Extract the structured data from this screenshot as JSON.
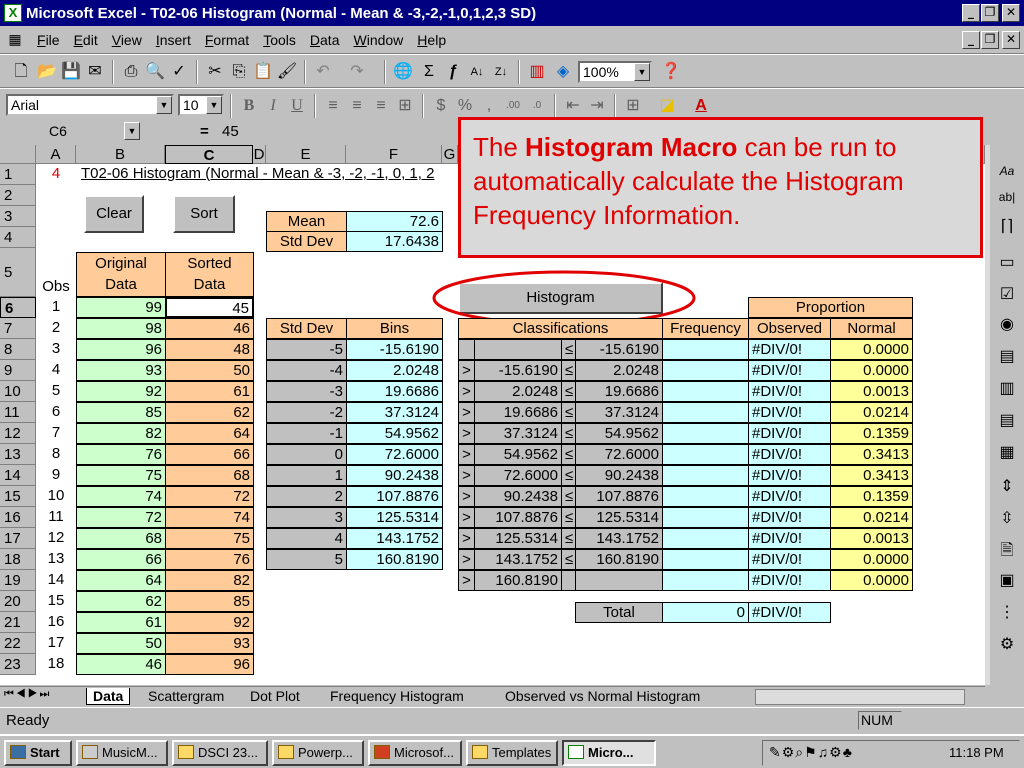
{
  "window": {
    "title": "Microsoft Excel - T02-06 Histogram (Normal - Mean & -3,-2,-1,0,1,2,3 SD)",
    "app_icon": "X"
  },
  "menu": [
    "File",
    "Edit",
    "View",
    "Insert",
    "Format",
    "Tools",
    "Data",
    "Window",
    "Help"
  ],
  "toolbar": {
    "zoom": "100%",
    "font": "Arial",
    "size": "10"
  },
  "formula": {
    "cell_ref": "C6",
    "equals": "=",
    "value": "45"
  },
  "columns": [
    "A",
    "B",
    "C",
    "D",
    "E",
    "F",
    "G"
  ],
  "rows": [
    "1",
    "2",
    "3",
    "4",
    "5",
    "6",
    "7",
    "8",
    "9",
    "10",
    "11",
    "12",
    "13",
    "14",
    "15",
    "16",
    "17",
    "18",
    "19",
    "20",
    "21",
    "22",
    "23"
  ],
  "sheet": {
    "a1": "4",
    "title": "T02-06 Histogram (Normal - Mean & -3, -2, -1, 0, 1, 2",
    "clear_btn": "Clear",
    "sort_btn": "Sort",
    "mean_label": "Mean",
    "mean_value": "72.6",
    "sd_label": "Std Dev",
    "sd_value": "17.6438",
    "obs_header": "Obs",
    "orig_header1": "Original",
    "orig_header2": "Data",
    "sorted_header1": "Sorted",
    "sorted_header2": "Data",
    "histogram_btn": "Histogram",
    "proportion_header": "Proportion",
    "col_headers": {
      "stddev": "Std Dev",
      "bins": "Bins",
      "classifications": "Classifications",
      "frequency": "Frequency",
      "observed": "Observed",
      "normal": "Normal"
    },
    "obs": [
      "1",
      "2",
      "3",
      "4",
      "5",
      "6",
      "7",
      "8",
      "9",
      "10",
      "11",
      "12",
      "13",
      "14",
      "15",
      "16",
      "17",
      "18"
    ],
    "original": [
      "99",
      "98",
      "96",
      "93",
      "92",
      "85",
      "82",
      "76",
      "75",
      "74",
      "72",
      "68",
      "66",
      "64",
      "62",
      "61",
      "50",
      "46"
    ],
    "sorted": [
      "45",
      "46",
      "48",
      "50",
      "61",
      "62",
      "64",
      "66",
      "68",
      "72",
      "74",
      "75",
      "76",
      "82",
      "85",
      "92",
      "93",
      "96"
    ],
    "stddevs": [
      "-5",
      "-4",
      "-3",
      "-2",
      "-1",
      "0",
      "1",
      "2",
      "3",
      "4",
      "5"
    ],
    "bins": [
      "-15.6190",
      "2.0248",
      "19.6686",
      "37.3124",
      "54.9562",
      "72.6000",
      "90.2438",
      "107.8876",
      "125.5314",
      "143.1752",
      "160.8190"
    ],
    "class_rows": [
      {
        "gt": "",
        "lo": "",
        "le": "≤",
        "hi": "-15.6190",
        "obs": "#DIV/0!",
        "norm": "0.0000"
      },
      {
        "gt": ">",
        "lo": "-15.6190",
        "le": "≤",
        "hi": "2.0248",
        "obs": "#DIV/0!",
        "norm": "0.0000"
      },
      {
        "gt": ">",
        "lo": "2.0248",
        "le": "≤",
        "hi": "19.6686",
        "obs": "#DIV/0!",
        "norm": "0.0013"
      },
      {
        "gt": ">",
        "lo": "19.6686",
        "le": "≤",
        "hi": "37.3124",
        "obs": "#DIV/0!",
        "norm": "0.0214"
      },
      {
        "gt": ">",
        "lo": "37.3124",
        "le": "≤",
        "hi": "54.9562",
        "obs": "#DIV/0!",
        "norm": "0.1359"
      },
      {
        "gt": ">",
        "lo": "54.9562",
        "le": "≤",
        "hi": "72.6000",
        "obs": "#DIV/0!",
        "norm": "0.3413"
      },
      {
        "gt": ">",
        "lo": "72.6000",
        "le": "≤",
        "hi": "90.2438",
        "obs": "#DIV/0!",
        "norm": "0.3413"
      },
      {
        "gt": ">",
        "lo": "90.2438",
        "le": "≤",
        "hi": "107.8876",
        "obs": "#DIV/0!",
        "norm": "0.1359"
      },
      {
        "gt": ">",
        "lo": "107.8876",
        "le": "≤",
        "hi": "125.5314",
        "obs": "#DIV/0!",
        "norm": "0.0214"
      },
      {
        "gt": ">",
        "lo": "125.5314",
        "le": "≤",
        "hi": "143.1752",
        "obs": "#DIV/0!",
        "norm": "0.0013"
      },
      {
        "gt": ">",
        "lo": "143.1752",
        "le": "≤",
        "hi": "160.8190",
        "obs": "#DIV/0!",
        "norm": "0.0000"
      },
      {
        "gt": ">",
        "lo": "160.8190",
        "le": "",
        "hi": "",
        "obs": "#DIV/0!",
        "norm": "0.0000"
      }
    ],
    "total_label": "Total",
    "total_value": "0",
    "total_observed": "#DIV/0!"
  },
  "callout": {
    "pre": "The ",
    "bold": "Histogram Macro",
    "post": " can be run to automatically calculate the Histogram Frequency Information."
  },
  "tabs": [
    "Data",
    "Scattergram",
    "Dot Plot",
    "Frequency Histogram",
    "Observed vs Normal Histogram"
  ],
  "status": {
    "text": "Ready",
    "num": "NUM"
  },
  "taskbar": {
    "start": "Start",
    "items": [
      "MusicM...",
      "DSCI 23...",
      "Powerp...",
      "Microsof...",
      "Templates",
      "Micro..."
    ],
    "clock": "11:18 PM"
  }
}
